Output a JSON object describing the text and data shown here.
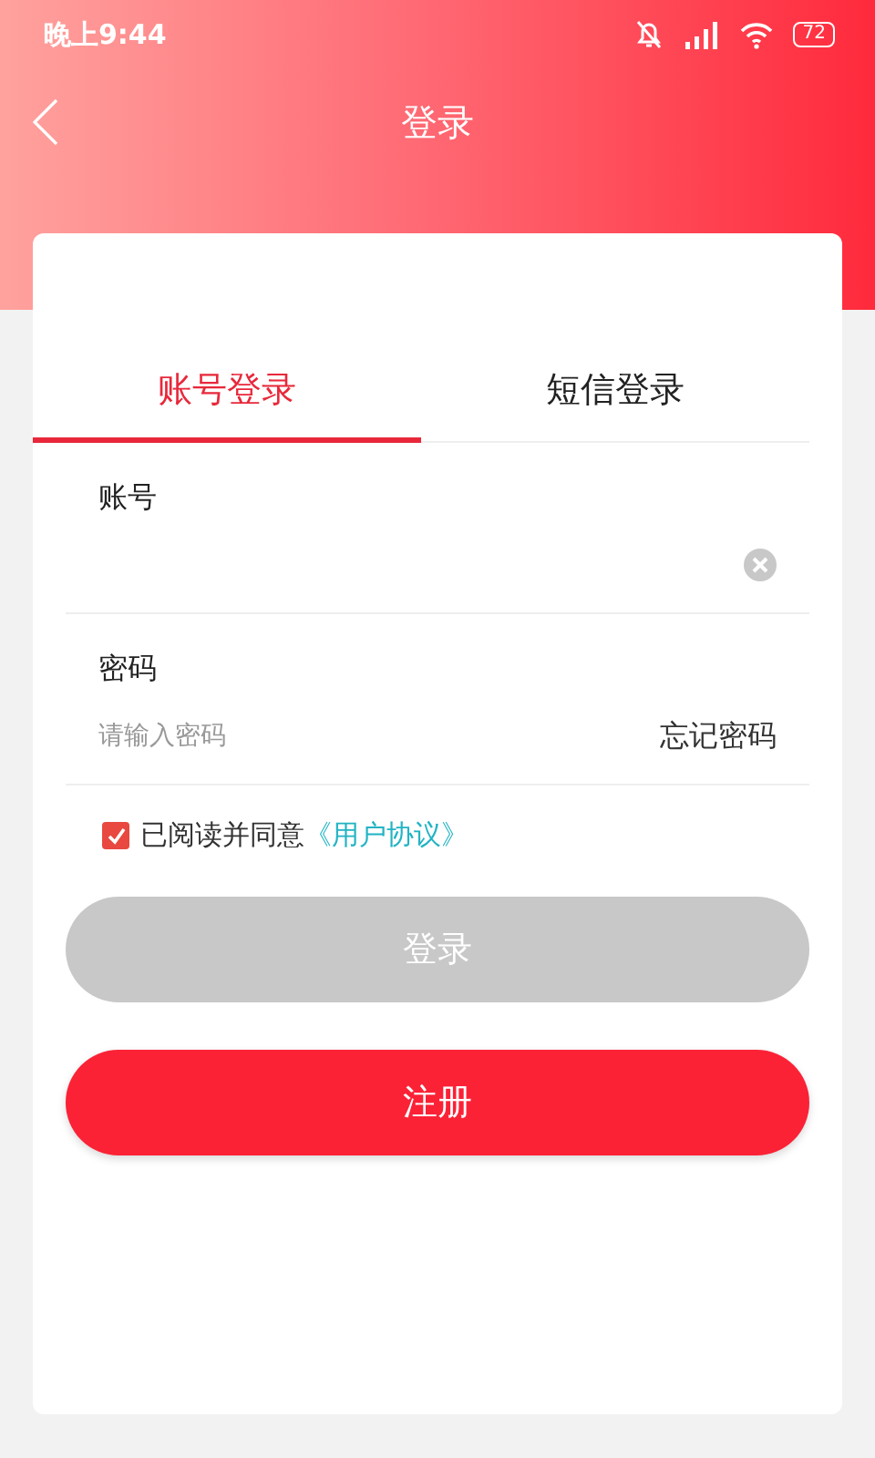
{
  "status_bar": {
    "time": "晚上9:44",
    "battery": "72"
  },
  "nav": {
    "title": "登录"
  },
  "tabs": [
    {
      "label": "账号登录",
      "selected": true
    },
    {
      "label": "短信登录",
      "selected": false
    }
  ],
  "account": {
    "label": "账号"
  },
  "password": {
    "label": "密码",
    "placeholder": "请输入密码",
    "forgot": "忘记密码"
  },
  "agreement": {
    "checked": true,
    "text": "已阅读并同意",
    "link": "《用户协议》"
  },
  "buttons": [
    {
      "label": "登录",
      "disabled": true
    },
    {
      "label": "注册",
      "disabled": false
    }
  ]
}
